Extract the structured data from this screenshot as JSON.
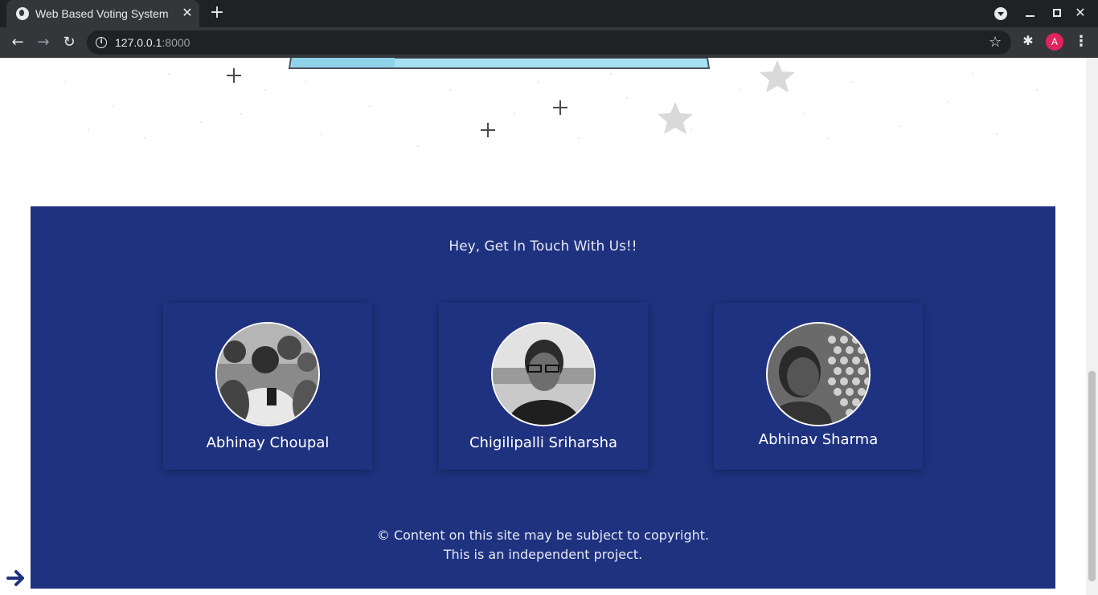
{
  "browser": {
    "tab_title": "Web Based Voting System",
    "url_host": "127.0.0.1",
    "url_port": ":8000",
    "profile_initial": "A"
  },
  "footer": {
    "heading": "Hey, Get In Touch With Us!!",
    "members": [
      {
        "name": "Abhinay Choupal"
      },
      {
        "name": "Chigilipalli Sriharsha"
      },
      {
        "name": "Abhinav Sharma"
      }
    ],
    "copyright_line1": "© Content on this site may be subject to copyright.",
    "copyright_line2": "This is an independent project."
  },
  "colors": {
    "footer_bg": "#1f3280",
    "chrome_dark": "#202124",
    "chrome_toolbar": "#35363a",
    "profile": "#e0245e"
  },
  "icons": [
    "globe-icon",
    "close-icon",
    "plus-icon",
    "tab-search-icon",
    "minimize-icon",
    "maximize-icon",
    "window-close-icon",
    "back-icon",
    "forward-icon",
    "reload-icon",
    "info-icon",
    "star-icon",
    "extensions-icon",
    "kebab-menu-icon",
    "arrow-right-icon"
  ]
}
